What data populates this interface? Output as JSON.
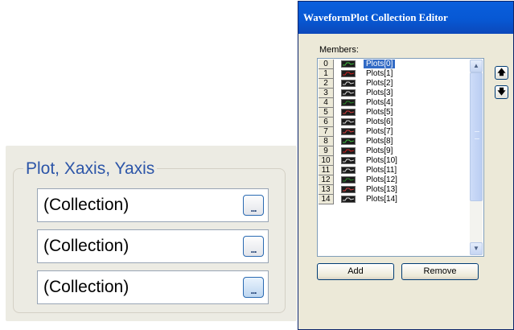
{
  "property_panel": {
    "group_title": "Plot, Xaxis, Yaxis",
    "fields": [
      {
        "value": "(Collection)",
        "button_label": "..."
      },
      {
        "value": "(Collection)",
        "button_label": "..."
      },
      {
        "value": "(Collection)",
        "button_label": "..."
      }
    ]
  },
  "editor": {
    "title": "WaveformPlot Collection Editor",
    "members_label": "Members:",
    "members": [
      {
        "index": "0",
        "label": "Plots[0]",
        "icon": "plot-icon",
        "color": "#3fbf3f",
        "selected": true
      },
      {
        "index": "1",
        "label": "Plots[1]",
        "icon": "plot-icon",
        "color": "#d02020"
      },
      {
        "index": "2",
        "label": "Plots[2]",
        "icon": "plot-icon",
        "color": "#e0e0e0"
      },
      {
        "index": "3",
        "label": "Plots[3]",
        "icon": "plot-icon",
        "color": "#e0e0e0"
      },
      {
        "index": "4",
        "label": "Plots[4]",
        "icon": "plot-icon",
        "color": "#2a8a2a"
      },
      {
        "index": "5",
        "label": "Plots[5]",
        "icon": "plot-icon",
        "color": "#d94040"
      },
      {
        "index": "6",
        "label": "Plots[6]",
        "icon": "plot-icon",
        "color": "#e0e0e0"
      },
      {
        "index": "7",
        "label": "Plots[7]",
        "icon": "plot-icon",
        "color": "#d94040"
      },
      {
        "index": "8",
        "label": "Plots[8]",
        "icon": "plot-icon",
        "color": "#3fbf3f"
      },
      {
        "index": "9",
        "label": "Plots[9]",
        "icon": "plot-icon",
        "color": "#d02020"
      },
      {
        "index": "10",
        "label": "Plots[10]",
        "icon": "plot-icon",
        "color": "#e0e0e0"
      },
      {
        "index": "11",
        "label": "Plots[11]",
        "icon": "plot-icon",
        "color": "#e0e0e0"
      },
      {
        "index": "12",
        "label": "Plots[12]",
        "icon": "plot-icon",
        "color": "#2a8a2a"
      },
      {
        "index": "13",
        "label": "Plots[13]",
        "icon": "plot-icon",
        "color": "#d94040"
      },
      {
        "index": "14",
        "label": "Plots[14]",
        "icon": "plot-icon",
        "color": "#e0e0e0"
      }
    ],
    "scroll_up_icon": "scroll-up-arrow-icon",
    "scroll_down_icon": "scroll-down-arrow-icon",
    "move_up_icon": "arrow-up-icon",
    "move_down_icon": "arrow-down-icon",
    "move_up_glyph": "🡅",
    "move_down_glyph": "🡇",
    "add_label": "Add",
    "remove_label": "Remove"
  }
}
